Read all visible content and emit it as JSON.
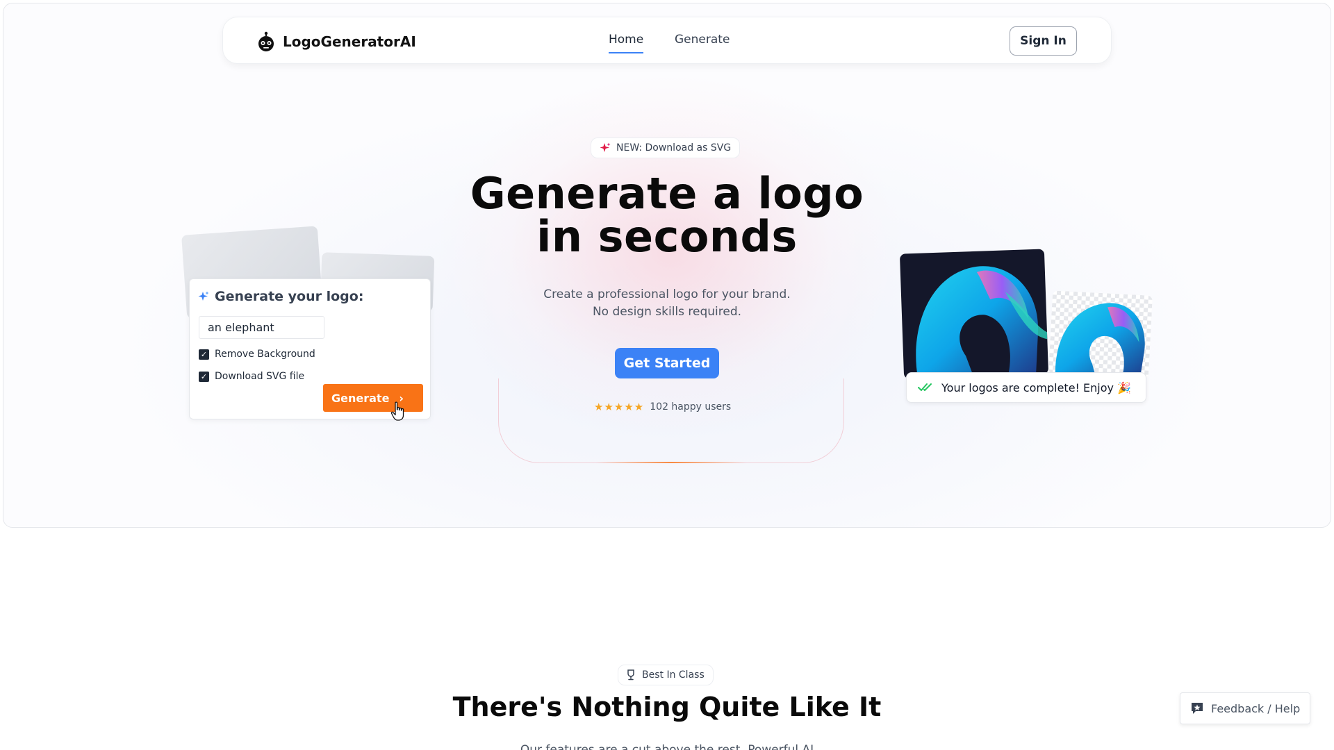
{
  "nav": {
    "brand": "LogoGeneratorAI",
    "links": [
      "Home",
      "Generate"
    ],
    "sign_in": "Sign In"
  },
  "hero": {
    "badge": "NEW: Download as SVG",
    "headline_line1": "Generate a logo",
    "headline_line2": "in seconds",
    "sub_line1": "Create a professional logo for your brand.",
    "sub_line2": "No design skills required.",
    "cta": "Get Started",
    "stars": "★★★★★",
    "rating_text": "102 happy users"
  },
  "generator_card": {
    "title": "Generate your logo:",
    "input_value": "an elephant",
    "options": [
      "Remove Background",
      "Download SVG file"
    ],
    "button": "Generate"
  },
  "result": {
    "toast": "Your logos are complete! Enjoy 🎉"
  },
  "features": {
    "badge": "Best In Class",
    "title": "There's Nothing Quite Like It",
    "subtitle": "Our features are a cut above the rest. Powerful AI"
  },
  "feedback": {
    "label": "Feedback / Help"
  },
  "colors": {
    "primary": "#3b82f6",
    "accent": "#f97316",
    "star": "#f5a524"
  }
}
